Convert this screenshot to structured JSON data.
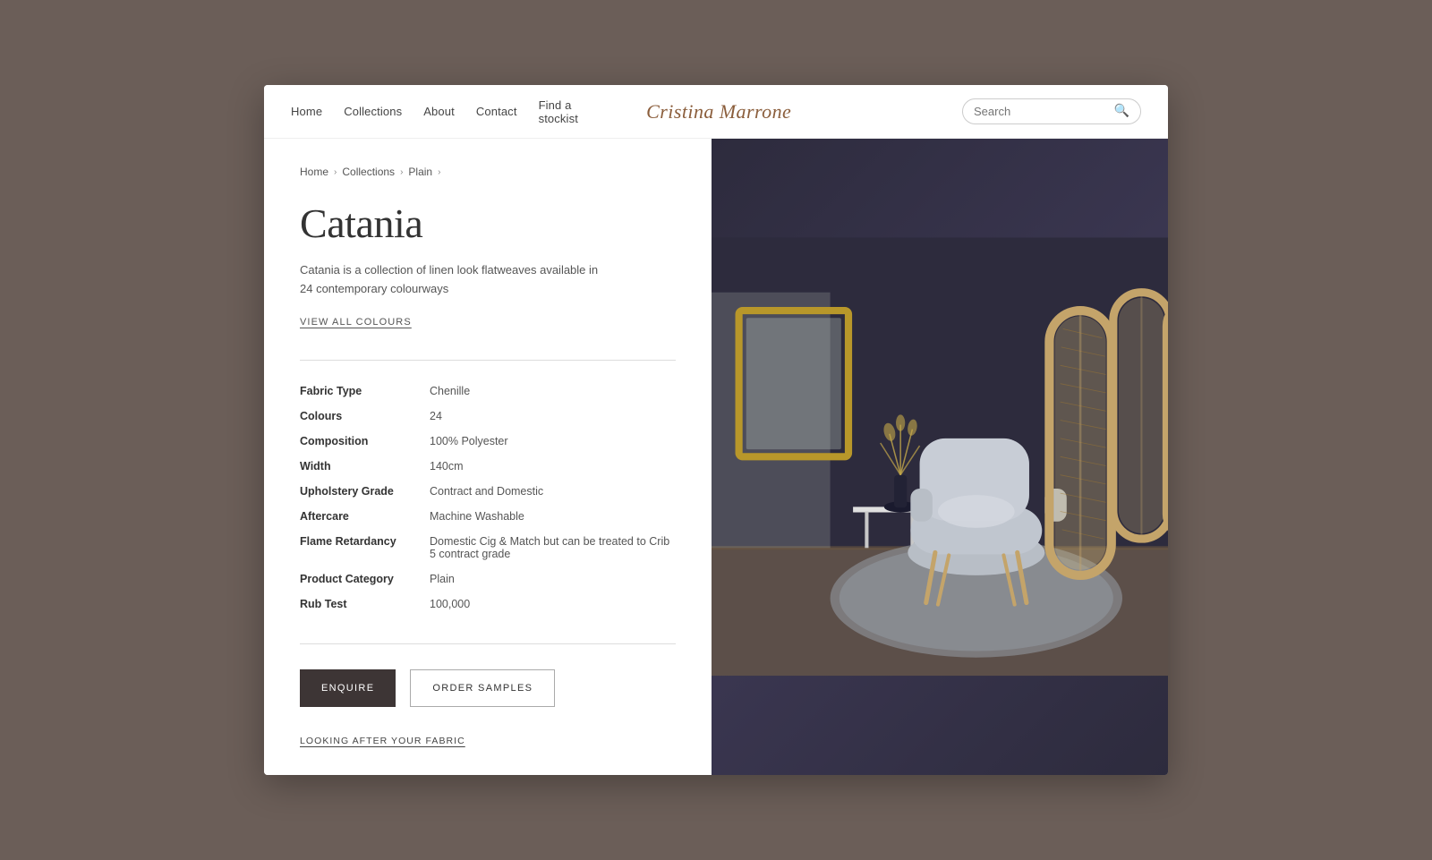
{
  "nav": {
    "links": [
      {
        "label": "Home",
        "id": "home"
      },
      {
        "label": "Collections",
        "id": "collections"
      },
      {
        "label": "About",
        "id": "about"
      },
      {
        "label": "Contact",
        "id": "contact"
      },
      {
        "label": "Find a stockist",
        "id": "stockist"
      }
    ],
    "brand": "Cristina Marrone",
    "search_placeholder": "Search"
  },
  "breadcrumb": {
    "items": [
      "Home",
      "Collections",
      "Plain"
    ]
  },
  "product": {
    "title": "Catania",
    "description": "Catania is a collection of linen look flatweaves available in 24 contemporary colourways",
    "view_colours_label": "VIEW ALL COLOURS",
    "specs": [
      {
        "label": "Fabric Type",
        "value": "Chenille"
      },
      {
        "label": "Colours",
        "value": "24"
      },
      {
        "label": "Composition",
        "value": "100% Polyester"
      },
      {
        "label": "Width",
        "value": "140cm"
      },
      {
        "label": "Upholstery Grade",
        "value": "Contract and Domestic"
      },
      {
        "label": "Aftercare",
        "value": "Machine Washable"
      },
      {
        "label": "Flame Retardancy",
        "value": "Domestic Cig & Match but can be treated to Crib 5 contract grade"
      },
      {
        "label": "Product Category",
        "value": "Plain"
      },
      {
        "label": "Rub Test",
        "value": "100,000"
      }
    ],
    "btn_enquire": "ENQUIRE",
    "btn_order": "ORDER SAMPLES",
    "fabric_care_label": "LOOKING AFTER YOUR FABRIC"
  }
}
